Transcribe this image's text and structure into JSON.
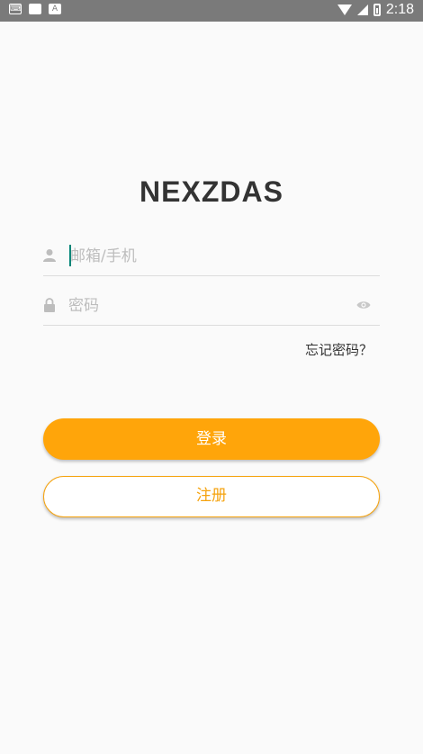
{
  "status_bar": {
    "time": "2:18",
    "notification_icons": [
      "keyboard-icon",
      "message-icon",
      "font-icon"
    ]
  },
  "app": {
    "brand": "NEXZDAS"
  },
  "login_form": {
    "account": {
      "placeholder": "邮箱/手机",
      "value": ""
    },
    "password": {
      "placeholder": "密码",
      "value": ""
    },
    "forgot_label": "忘记密码？",
    "login_label": "登录",
    "register_label": "注册"
  },
  "colors": {
    "accent": "#ffa50a",
    "caret": "#008577",
    "status_bar": "#7a7a7a"
  }
}
